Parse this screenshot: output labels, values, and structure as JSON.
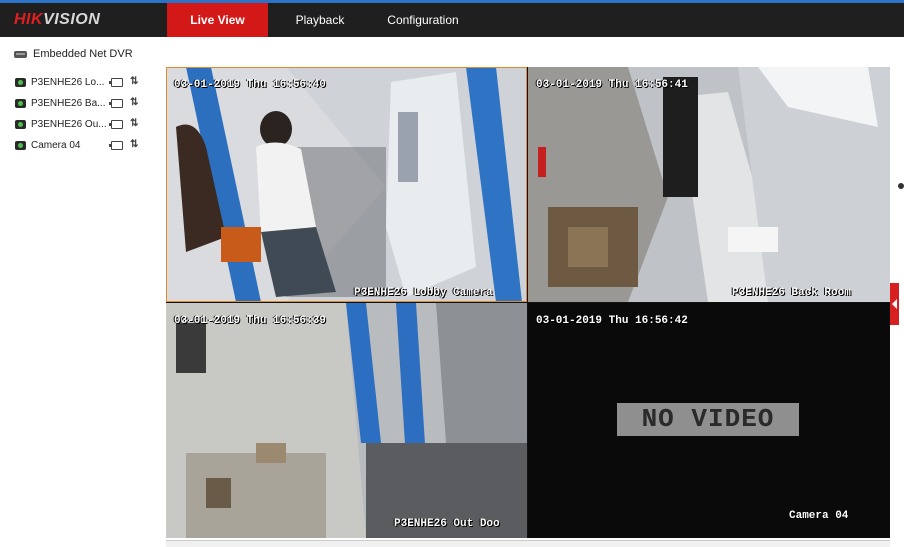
{
  "header": {
    "brand_red": "HIK",
    "brand_rest": "VISION",
    "tabs": [
      {
        "label": "Live View",
        "active": true
      },
      {
        "label": "Playback",
        "active": false
      },
      {
        "label": "Configuration",
        "active": false
      }
    ]
  },
  "sidebar": {
    "device_label": "Embedded Net DVR",
    "cameras": [
      {
        "label": "P3ENHE26 Lo..."
      },
      {
        "label": "P3ENHE26 Ba..."
      },
      {
        "label": "P3ENHE26 Ou..."
      },
      {
        "label": "Camera 04"
      }
    ]
  },
  "tiles": [
    {
      "timestamp": "03-01-2019 Thu 16:56:40",
      "name": "P3ENHE26 Lobby Camera"
    },
    {
      "timestamp": "03-01-2019 Thu 16:56:41",
      "name": "P3ENHE26 Back Room"
    },
    {
      "timestamp": "03-01-2019 Thu 16:56:39",
      "name": "P3ENHE26 Out Doo"
    },
    {
      "timestamp": "03-01-2019 Thu 16:56:42",
      "name": "Camera 04",
      "no_video": "NO VIDEO"
    }
  ],
  "colors": {
    "brand": "#d31818",
    "header_bg": "#1f1f1f",
    "selected_tile_border": "#e08a2b"
  },
  "icons": {
    "device": "dvr-icon",
    "camera_status": "camera-icon",
    "record": "record-icon",
    "ptz": "ptz-icon"
  }
}
